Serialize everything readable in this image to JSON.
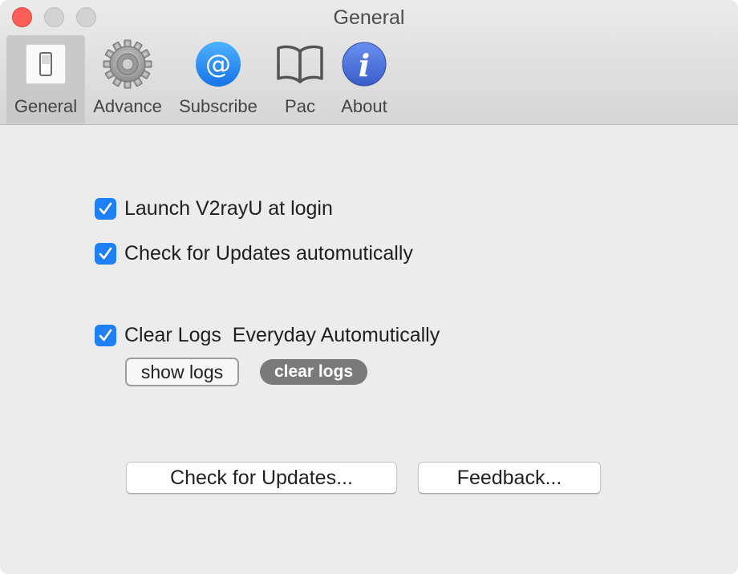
{
  "window": {
    "title": "General"
  },
  "toolbar": {
    "tabs": [
      {
        "label": "General",
        "icon": "switch-icon",
        "selected": true
      },
      {
        "label": "Advance",
        "icon": "gear-icon",
        "selected": false
      },
      {
        "label": "Subscribe",
        "icon": "at-sign-icon",
        "selected": false
      },
      {
        "label": "Pac",
        "icon": "book-icon",
        "selected": false
      },
      {
        "label": "About",
        "icon": "info-icon",
        "selected": false
      }
    ]
  },
  "settings": {
    "launch_at_login": {
      "label": "Launch V2rayU at login",
      "checked": true
    },
    "check_updates_auto": {
      "label": "Check for Updates automutically",
      "checked": true
    },
    "clear_logs": {
      "label": "Clear Logs  Everyday Automutically",
      "checked": true
    }
  },
  "logs": {
    "show_logs_label": "show logs",
    "clear_logs_label": "clear logs"
  },
  "actions": {
    "check_updates_label": "Check for Updates...",
    "feedback_label": "Feedback..."
  },
  "colors": {
    "accent": "#1f7ff5",
    "close": "#fc5f57"
  }
}
